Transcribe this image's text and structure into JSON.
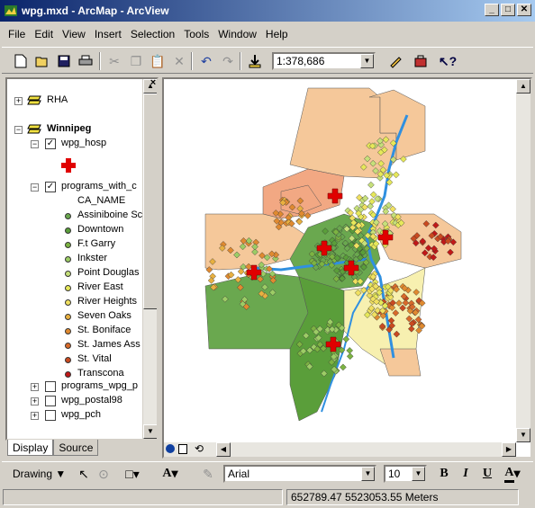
{
  "window": {
    "title": "wpg.mxd - ArcMap - ArcView",
    "minimize": "_",
    "maximize": "□",
    "close": "✕"
  },
  "menu": [
    "File",
    "Edit",
    "View",
    "Insert",
    "Selection",
    "Tools",
    "Window",
    "Help"
  ],
  "toolbar": {
    "scale": "1:378,686"
  },
  "toc": {
    "layers": [
      {
        "name": "RHA",
        "expanded": false
      },
      {
        "name": "Winnipeg",
        "expanded": true
      }
    ],
    "wpg_hosp": {
      "name": "wpg_hosp",
      "checked": true
    },
    "programs": {
      "name": "programs_with_c",
      "checked": true,
      "field": "CA_NAME"
    },
    "classes": [
      {
        "label": "Assiniboine Sc",
        "color": "#6aa84f"
      },
      {
        "label": "Downtown",
        "color": "#5a9e3a"
      },
      {
        "label": "F.t Garry",
        "color": "#7cb342"
      },
      {
        "label": "Inkster",
        "color": "#9ccc65"
      },
      {
        "label": "Point Douglas",
        "color": "#c6e07a"
      },
      {
        "label": "River East",
        "color": "#e6e85a"
      },
      {
        "label": "River Heights",
        "color": "#f0e060"
      },
      {
        "label": "Seven Oaks",
        "color": "#e8b040"
      },
      {
        "label": "St. Boniface",
        "color": "#e08a30"
      },
      {
        "label": "St. James Ass",
        "color": "#d86a2a"
      },
      {
        "label": "St. Vital",
        "color": "#c94a20"
      },
      {
        "label": "Transcona",
        "color": "#c01818"
      }
    ],
    "other_layers": [
      {
        "name": "programs_wpg_p",
        "checked": false
      },
      {
        "name": "wpg_postal98",
        "checked": false
      },
      {
        "name": "wpg_pch",
        "checked": false
      }
    ]
  },
  "tabs": [
    "Display",
    "Source"
  ],
  "drawing": {
    "label": "Drawing",
    "font": "Arial",
    "size": "10",
    "bold": "B",
    "italic": "I",
    "underline": "U",
    "text_tool": "A"
  },
  "status": {
    "coords": "652789.47  5523053.55 Meters"
  }
}
